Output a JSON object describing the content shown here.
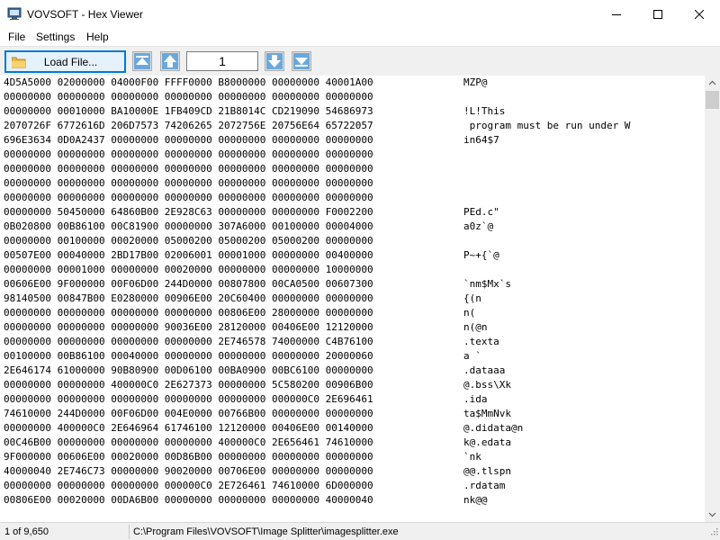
{
  "window": {
    "title": "VOVSOFT - Hex Viewer",
    "icon": "hex-viewer-app-icon",
    "controls": [
      "minimize-icon",
      "maximize-icon",
      "close-icon"
    ]
  },
  "menu": {
    "items": [
      "File",
      "Settings",
      "Help"
    ]
  },
  "toolbar": {
    "load_label": "Load File...",
    "load_icon": "folder-icon",
    "page_value": "1",
    "nav_icons": [
      "first-page-icon",
      "previous-page-icon",
      "next-page-icon",
      "last-page-icon"
    ],
    "accent_color": "#0078d7"
  },
  "hex_rows": [
    {
      "hex": "4D5A5000 02000000 04000F00 FFFF0000 B8000000 00000000 40001A00",
      "ascii": "MZP@"
    },
    {
      "hex": "00000000 00000000 00000000 00000000 00000000 00000000 00000000",
      "ascii": ""
    },
    {
      "hex": "00000000 00010000 BA10000E 1FB409CD 21B8014C CD219090 54686973",
      "ascii": "!L!This"
    },
    {
      "hex": "2070726F 6772616D 206D7573 74206265 2072756E 20756E64 65722057",
      "ascii": " program must be run under W"
    },
    {
      "hex": "696E3634 0D0A2437 00000000 00000000 00000000 00000000 00000000",
      "ascii": "in64$7"
    },
    {
      "hex": "00000000 00000000 00000000 00000000 00000000 00000000 00000000",
      "ascii": ""
    },
    {
      "hex": "00000000 00000000 00000000 00000000 00000000 00000000 00000000",
      "ascii": ""
    },
    {
      "hex": "00000000 00000000 00000000 00000000 00000000 00000000 00000000",
      "ascii": ""
    },
    {
      "hex": "00000000 00000000 00000000 00000000 00000000 00000000 00000000",
      "ascii": ""
    },
    {
      "hex": "00000000 50450000 64860B00 2E928C63 00000000 00000000 F0002200",
      "ascii": "PEd.c\""
    },
    {
      "hex": "0B020800 00B86100 00C81900 00000000 307A6000 00100000 00004000",
      "ascii": "a0z`@"
    },
    {
      "hex": "00000000 00100000 00020000 05000200 05000200 05000200 00000000",
      "ascii": ""
    },
    {
      "hex": "00507E00 00040000 2BD17B00 02006001 00001000 00000000 00400000",
      "ascii": "P~+{`@"
    },
    {
      "hex": "00000000 00001000 00000000 00020000 00000000 00000000 10000000",
      "ascii": ""
    },
    {
      "hex": "00606E00 9F000000 00F06D00 244D0000 00807800 00CA0500 00607300",
      "ascii": "`nm$Mx`s"
    },
    {
      "hex": "98140500 00847B00 E0280000 00906E00 20C60400 00000000 00000000",
      "ascii": "{(n"
    },
    {
      "hex": "00000000 00000000 00000000 00000000 00806E00 28000000 00000000",
      "ascii": "n("
    },
    {
      "hex": "00000000 00000000 00000000 90036E00 28120000 00406E00 12120000",
      "ascii": "n(@n"
    },
    {
      "hex": "00000000 00000000 00000000 00000000 2E746578 74000000 C4B76100",
      "ascii": ".texta"
    },
    {
      "hex": "00100000 00B86100 00040000 00000000 00000000 00000000 20000060",
      "ascii": "a `"
    },
    {
      "hex": "2E646174 61000000 90B80900 00D06100 00BA0900 00BC6100 00000000",
      "ascii": ".dataaa"
    },
    {
      "hex": "00000000 00000000 400000C0 2E627373 00000000 5C580200 00906B00",
      "ascii": "@.bss\\Xk"
    },
    {
      "hex": "00000000 00000000 00000000 00000000 00000000 000000C0 2E696461",
      "ascii": ".ida"
    },
    {
      "hex": "74610000 244D0000 00F06D00 004E0000 00766B00 00000000 00000000",
      "ascii": "ta$MmNvk"
    },
    {
      "hex": "00000000 400000C0 2E646964 61746100 12120000 00406E00 00140000",
      "ascii": "@.didata@n"
    },
    {
      "hex": "00C46B00 00000000 00000000 00000000 400000C0 2E656461 74610000",
      "ascii": "k@.edata"
    },
    {
      "hex": "9F000000 00606E00 00020000 00D86B00 00000000 00000000 00000000",
      "ascii": "`nk"
    },
    {
      "hex": "40000040 2E746C73 00000000 90020000 00706E00 00000000 00000000",
      "ascii": "@@.tlspn"
    },
    {
      "hex": "00000000 00000000 00000000 000000C0 2E726461 74610000 6D000000",
      "ascii": ".rdatam"
    },
    {
      "hex": "00806E00 00020000 00DA6B00 00000000 00000000 00000000 40000040",
      "ascii": "nk@@"
    }
  ],
  "status": {
    "page_count": "1 of 9,650",
    "file_path": "C:\\Program Files\\VOVSOFT\\Image Splitter\\imagesplitter.exe"
  }
}
